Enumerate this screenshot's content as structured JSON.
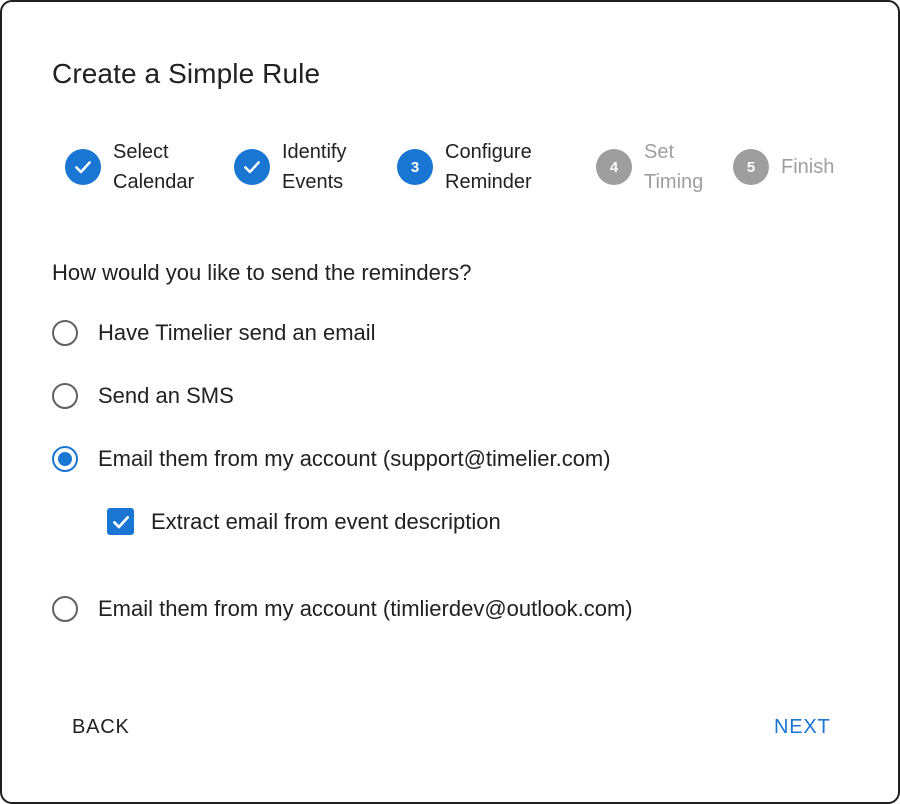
{
  "dialog": {
    "title": "Create a Simple Rule"
  },
  "stepper": {
    "steps": [
      {
        "number": "1",
        "line1": "Select",
        "line2": "Calendar",
        "state": "completed"
      },
      {
        "number": "2",
        "line1": "Identify",
        "line2": "Events",
        "state": "completed"
      },
      {
        "number": "3",
        "line1": "Configure",
        "line2": "Reminder",
        "state": "active"
      },
      {
        "number": "4",
        "line1": "Set",
        "line2": "Timing",
        "state": "inactive"
      },
      {
        "number": "5",
        "line1": "Finish",
        "line2": "",
        "state": "inactive"
      }
    ],
    "check_icon": "check-icon",
    "active_color": "#1976d2",
    "inactive_color": "#9e9e9e"
  },
  "form": {
    "question": "How would you like to send the reminders?",
    "options": [
      {
        "label": "Have Timelier send an email",
        "selected": false
      },
      {
        "label": "Send an SMS",
        "selected": false
      },
      {
        "label": "Email them from my account (support@timelier.com)",
        "selected": true
      },
      {
        "label": "Email them from my account (timlierdev@outlook.com)",
        "selected": false
      }
    ],
    "extract_checkbox": {
      "label": "Extract email from event description",
      "checked": true
    }
  },
  "actions": {
    "back_label": "BACK",
    "next_label": "NEXT"
  }
}
